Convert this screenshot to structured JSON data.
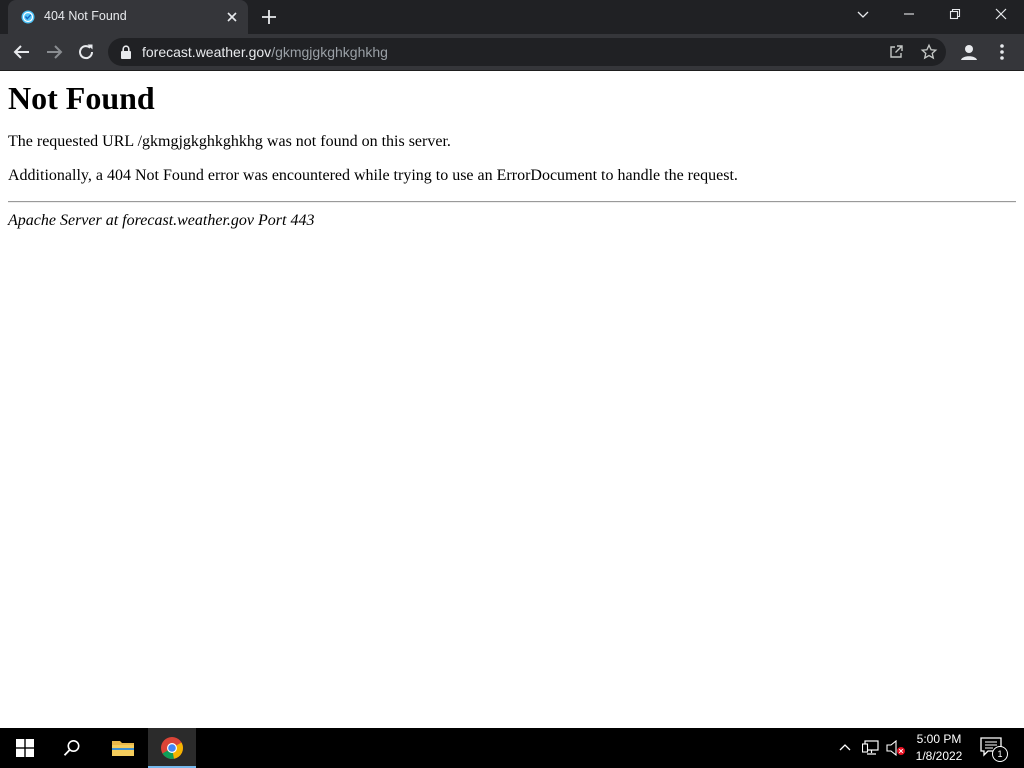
{
  "browser": {
    "tab": {
      "title": "404 Not Found",
      "favicon": "noaa-globe-icon"
    },
    "omnibox": {
      "host": "forecast.weather.gov",
      "path": "/gkmgjgkghkghkhg"
    },
    "icons": [
      "back-arrow-icon",
      "forward-arrow-icon",
      "reload-icon",
      "lock-icon",
      "share-icon",
      "star-icon",
      "profile-icon",
      "kebab-menu-icon",
      "tab-search-chevron-icon",
      "minimize-icon",
      "restore-icon",
      "close-icon"
    ],
    "colors": {
      "titlebar": "#202124",
      "toolbar": "#35363a",
      "omnibox": "#202124"
    }
  },
  "page": {
    "heading": "Not Found",
    "message": "The requested URL /gkmgjgkghkghkhg was not found on this server.",
    "additional": "Additionally, a 404 Not Found error was encountered while trying to use an ErrorDocument to handle the request.",
    "address": "Apache Server at forecast.weather.gov Port 443"
  },
  "taskbar": {
    "pinned": [
      "windows-start-icon",
      "search-icon",
      "file-explorer-icon",
      "chrome-icon"
    ],
    "tray_icons": [
      "chevron-up-icon",
      "network-icon",
      "volume-muted-icon"
    ],
    "clock": {
      "time": "5:00 PM",
      "date": "1/8/2022"
    },
    "notifications": {
      "count": "1"
    }
  }
}
